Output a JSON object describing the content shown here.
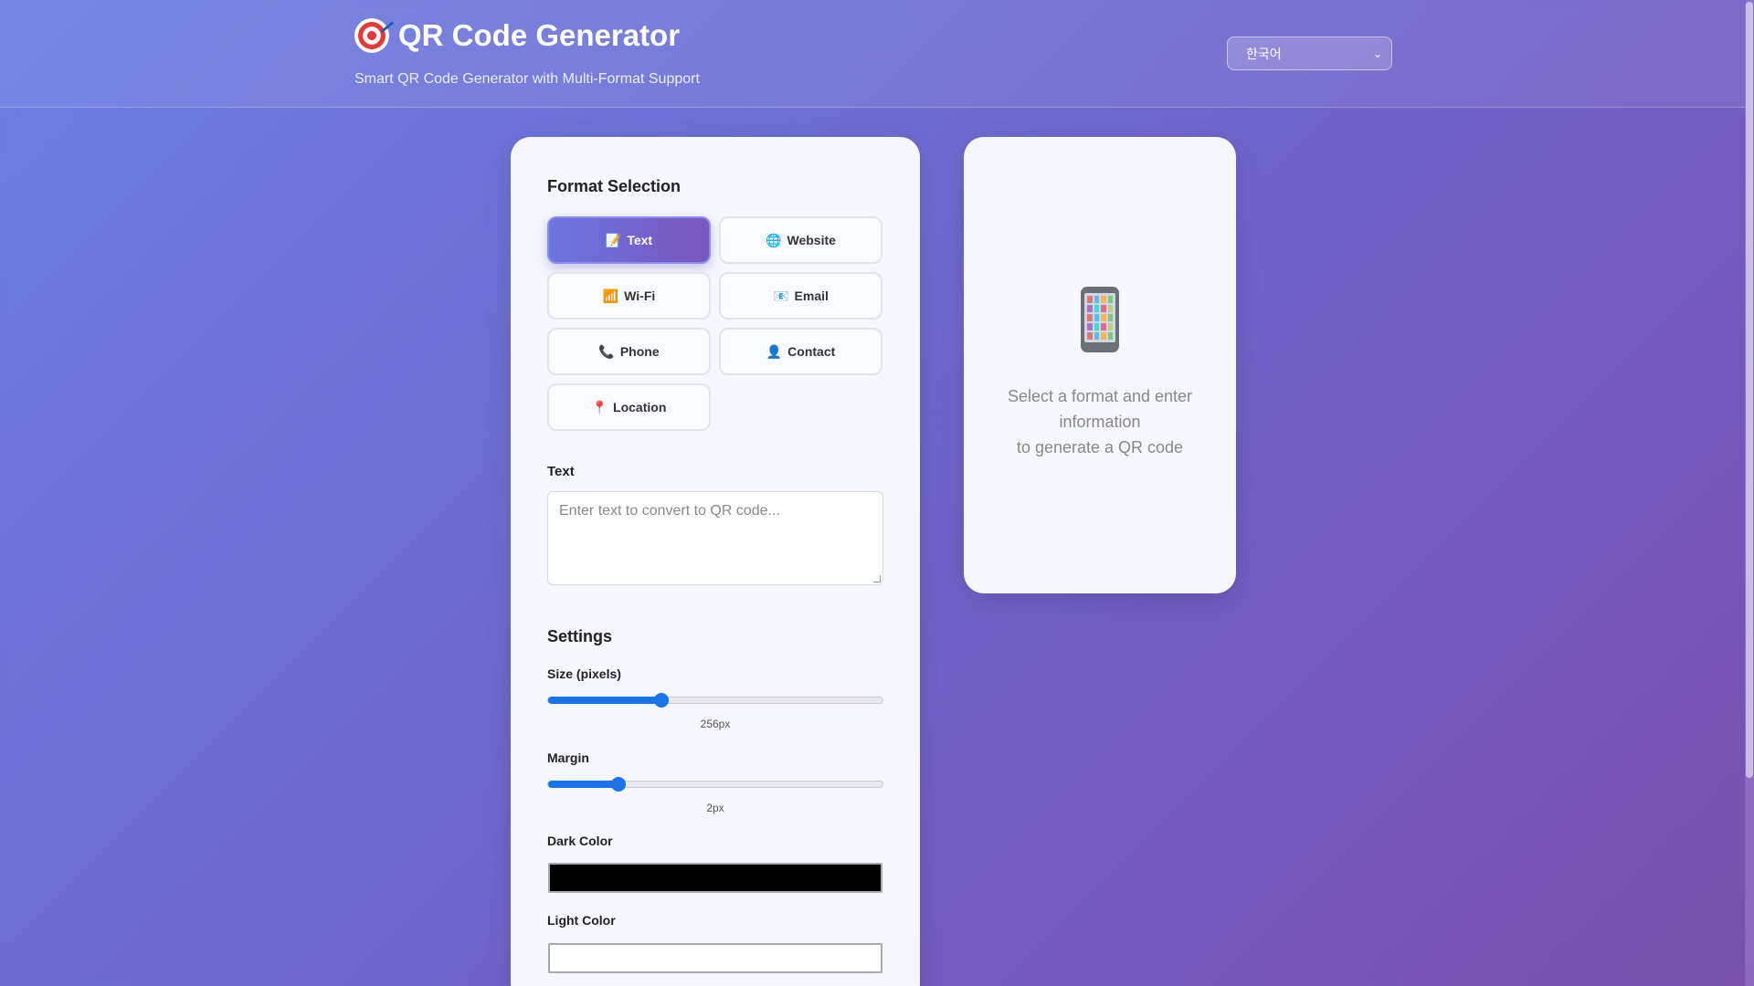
{
  "header": {
    "title": "QR Code Generator",
    "subtitle": "Smart QR Code Generator with Multi-Format Support",
    "logo_icon": "target-icon",
    "language": {
      "selected": "한국어"
    }
  },
  "form": {
    "format_section_title": "Format Selection",
    "formats": [
      {
        "icon": "📝",
        "label": "Text",
        "active": true
      },
      {
        "icon": "🌐",
        "label": "Website",
        "active": false
      },
      {
        "icon": "📶",
        "label": "Wi-Fi",
        "active": false
      },
      {
        "icon": "📧",
        "label": "Email",
        "active": false
      },
      {
        "icon": "📞",
        "label": "Phone",
        "active": false
      },
      {
        "icon": "👤",
        "label": "Contact",
        "active": false
      },
      {
        "icon": "📍",
        "label": "Location",
        "active": false
      }
    ],
    "text_label": "Text",
    "text_placeholder": "Enter text to convert to QR code...",
    "settings_title": "Settings",
    "size": {
      "label": "Size (pixels)",
      "value_text": "256px",
      "fraction": 0.34
    },
    "margin": {
      "label": "Margin",
      "value_text": "2px",
      "fraction": 0.21
    },
    "dark_color": {
      "label": "Dark Color",
      "value": "#000000"
    },
    "light_color": {
      "label": "Light Color",
      "value": "#ffffff"
    }
  },
  "preview": {
    "icon": "mobile-phone-icon",
    "message": "Select a format and enter\ninformation\nto generate a QR code"
  }
}
